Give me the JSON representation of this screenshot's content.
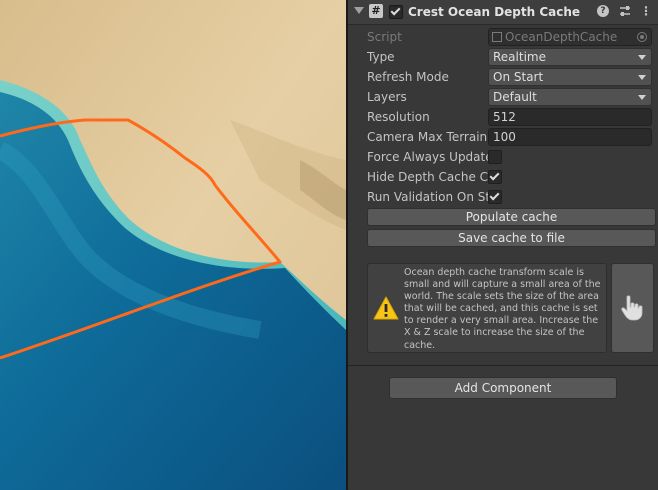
{
  "component": {
    "title": "Crest Ocean Depth Cache",
    "enabled": true,
    "icon": "csharp-script-icon",
    "header_icons": [
      "help-icon",
      "preset-icon",
      "more-options-icon"
    ]
  },
  "fields": {
    "script": {
      "label": "Script",
      "value": "OceanDepthCache"
    },
    "type": {
      "label": "Type",
      "value": "Realtime"
    },
    "refresh_mode": {
      "label": "Refresh Mode",
      "value": "On Start"
    },
    "layers": {
      "label": "Layers",
      "value": "Default"
    },
    "resolution": {
      "label": "Resolution",
      "value": "512"
    },
    "camera_max_terrain": {
      "label": "Camera Max Terrain I",
      "value": "100"
    },
    "force_always_update": {
      "label": "Force Always Update",
      "checked": false
    },
    "hide_depth_cache": {
      "label": "Hide Depth Cache Ca",
      "checked": true
    },
    "run_validation": {
      "label": "Run Validation On Sta",
      "checked": true
    }
  },
  "buttons": {
    "populate": "Populate cache",
    "save": "Save cache to file",
    "add_component": "Add Component"
  },
  "help_box": {
    "type": "warning",
    "message": "Ocean depth cache transform scale is small and will capture a small area of the world. The scale sets the size of the area that will be cached, and this cache is set to render a very small area. Increase the X & Z scale to increase the size of the cache.",
    "fix_icon": "pointing-hand-icon"
  },
  "scene": {
    "water_deep": "#0f5d8c",
    "water_shallow": "#4fc3c6",
    "sand": "#e3cba0",
    "outline_color": "#ff6a1a"
  }
}
